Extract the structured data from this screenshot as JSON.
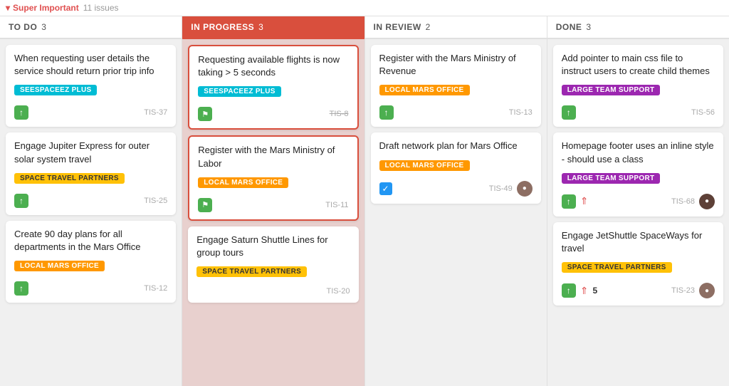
{
  "board": {
    "group": {
      "label": "Super Important",
      "issue_count_label": "11 issues",
      "chevron": "▾"
    },
    "columns": [
      {
        "id": "todo",
        "header": "TO DO",
        "count": "3",
        "bg": "normal",
        "cards": [
          {
            "id": "c1",
            "title": "When requesting user details the service should return prior trip info",
            "tag": "SEESPACEEZ PLUS",
            "tag_color": "cyan",
            "card_id": "TIS-37",
            "strikethrough": false,
            "highlighted": false,
            "has_up_arrow": true,
            "has_bookmark": false,
            "has_avatar": false,
            "has_checkbox": false,
            "has_double_arrow": false,
            "badge_count": null
          },
          {
            "id": "c2",
            "title": "Engage Jupiter Express for outer solar system travel",
            "tag": "SPACE TRAVEL PARTNERS",
            "tag_color": "yellow",
            "card_id": "TIS-25",
            "strikethrough": false,
            "highlighted": false,
            "has_up_arrow": true,
            "has_bookmark": false,
            "has_avatar": false,
            "has_checkbox": false,
            "has_double_arrow": false,
            "badge_count": null
          },
          {
            "id": "c3",
            "title": "Create 90 day plans for all departments in the Mars Office",
            "tag": "LOCAL MARS OFFICE",
            "tag_color": "orange",
            "card_id": "TIS-12",
            "strikethrough": false,
            "highlighted": false,
            "has_up_arrow": true,
            "has_bookmark": false,
            "has_avatar": false,
            "has_checkbox": false,
            "has_double_arrow": false,
            "badge_count": null
          }
        ]
      },
      {
        "id": "inprogress",
        "header": "IN PROGRESS",
        "count": "3",
        "bg": "in-progress",
        "cards": [
          {
            "id": "c4",
            "title": "Requesting available flights is now taking > 5 seconds",
            "tag": "SEESPACEEZ PLUS",
            "tag_color": "cyan",
            "card_id": "TIS-8",
            "strikethrough": true,
            "highlighted": true,
            "has_up_arrow": false,
            "has_bookmark": true,
            "has_avatar": false,
            "has_checkbox": false,
            "has_double_arrow": false,
            "badge_count": null
          },
          {
            "id": "c5",
            "title": "Register with the Mars Ministry of Labor",
            "tag": "LOCAL MARS OFFICE",
            "tag_color": "orange",
            "card_id": "TIS-11",
            "strikethrough": false,
            "highlighted": true,
            "has_up_arrow": false,
            "has_bookmark": true,
            "has_avatar": false,
            "has_checkbox": false,
            "has_double_arrow": false,
            "badge_count": null
          },
          {
            "id": "c6",
            "title": "Engage Saturn Shuttle Lines for group tours",
            "tag": "SPACE TRAVEL PARTNERS",
            "tag_color": "yellow",
            "card_id": "TIS-20",
            "strikethrough": false,
            "highlighted": false,
            "has_up_arrow": false,
            "has_bookmark": false,
            "has_avatar": false,
            "has_checkbox": false,
            "has_double_arrow": false,
            "badge_count": null
          }
        ]
      },
      {
        "id": "inreview",
        "header": "IN REVIEW",
        "count": "2",
        "bg": "normal",
        "cards": [
          {
            "id": "c7",
            "title": "Register with the Mars Ministry of Revenue",
            "tag": "LOCAL MARS OFFICE",
            "tag_color": "orange",
            "card_id": "TIS-13",
            "strikethrough": false,
            "highlighted": false,
            "has_up_arrow": true,
            "has_bookmark": false,
            "has_avatar": false,
            "has_checkbox": false,
            "has_double_arrow": false,
            "badge_count": null
          },
          {
            "id": "c8",
            "title": "Draft network plan for Mars Office",
            "tag": "LOCAL MARS OFFICE",
            "tag_color": "orange",
            "card_id": "TIS-49",
            "strikethrough": false,
            "highlighted": false,
            "has_up_arrow": false,
            "has_bookmark": false,
            "has_avatar": true,
            "avatar_color": "brown",
            "has_checkbox": true,
            "has_double_arrow": false,
            "badge_count": null
          }
        ]
      },
      {
        "id": "done",
        "header": "DONE",
        "count": "3",
        "bg": "normal",
        "cards": [
          {
            "id": "c9",
            "title": "Add pointer to main css file to instruct users to create child themes",
            "tag": "LARGE TEAM SUPPORT",
            "tag_color": "purple",
            "card_id": "TIS-56",
            "strikethrough": false,
            "highlighted": false,
            "has_up_arrow": true,
            "has_bookmark": false,
            "has_avatar": false,
            "has_checkbox": false,
            "has_double_arrow": false,
            "badge_count": null
          },
          {
            "id": "c10",
            "title": "Homepage footer uses an inline style - should use a class",
            "tag": "LARGE TEAM SUPPORT",
            "tag_color": "purple",
            "card_id": "TIS-68",
            "strikethrough": false,
            "highlighted": false,
            "has_up_arrow": true,
            "has_bookmark": false,
            "has_avatar": true,
            "avatar_color": "dark",
            "has_checkbox": false,
            "has_double_arrow": true,
            "badge_count": null
          },
          {
            "id": "c11",
            "title": "Engage JetShuttle SpaceWays for travel",
            "tag": "SPACE TRAVEL PARTNERS",
            "tag_color": "yellow",
            "card_id": "TIS-23",
            "strikethrough": false,
            "highlighted": false,
            "has_up_arrow": true,
            "has_bookmark": false,
            "has_avatar": true,
            "avatar_color": "brown",
            "has_checkbox": false,
            "has_double_arrow": true,
            "badge_count": "5"
          }
        ]
      }
    ]
  }
}
